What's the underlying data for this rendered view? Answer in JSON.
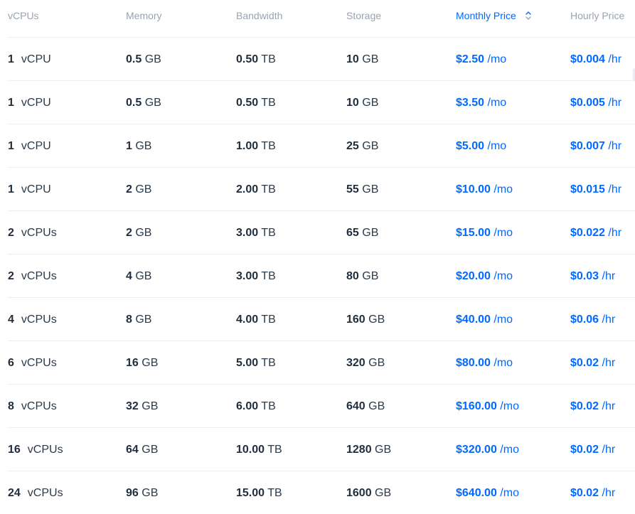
{
  "headers": {
    "vcpus": "vCPUs",
    "memory": "Memory",
    "bandwidth": "Bandwidth",
    "storage": "Storage",
    "monthly_price": "Monthly Price",
    "hourly_price": "Hourly Price"
  },
  "accent_color": "#0069ff",
  "sort_icon": "sort-up-down-icon",
  "rows": [
    {
      "vcpu": "1",
      "vcpu_unit": "vCPU",
      "memory": "0.5",
      "memory_unit": "GB",
      "bandwidth": "0.50",
      "bandwidth_unit": "TB",
      "storage": "10",
      "storage_unit": "GB",
      "monthly": "$2.50",
      "monthly_unit": "/mo",
      "hourly": "$0.004",
      "hourly_unit": "/hr"
    },
    {
      "vcpu": "1",
      "vcpu_unit": "vCPU",
      "memory": "0.5",
      "memory_unit": "GB",
      "bandwidth": "0.50",
      "bandwidth_unit": "TB",
      "storage": "10",
      "storage_unit": "GB",
      "monthly": "$3.50",
      "monthly_unit": "/mo",
      "hourly": "$0.005",
      "hourly_unit": "/hr"
    },
    {
      "vcpu": "1",
      "vcpu_unit": "vCPU",
      "memory": "1",
      "memory_unit": "GB",
      "bandwidth": "1.00",
      "bandwidth_unit": "TB",
      "storage": "25",
      "storage_unit": "GB",
      "monthly": "$5.00",
      "monthly_unit": "/mo",
      "hourly": "$0.007",
      "hourly_unit": "/hr"
    },
    {
      "vcpu": "1",
      "vcpu_unit": "vCPU",
      "memory": "2",
      "memory_unit": "GB",
      "bandwidth": "2.00",
      "bandwidth_unit": "TB",
      "storage": "55",
      "storage_unit": "GB",
      "monthly": "$10.00",
      "monthly_unit": "/mo",
      "hourly": "$0.015",
      "hourly_unit": "/hr"
    },
    {
      "vcpu": "2",
      "vcpu_unit": "vCPUs",
      "memory": "2",
      "memory_unit": "GB",
      "bandwidth": "3.00",
      "bandwidth_unit": "TB",
      "storage": "65",
      "storage_unit": "GB",
      "monthly": "$15.00",
      "monthly_unit": "/mo",
      "hourly": "$0.022",
      "hourly_unit": "/hr"
    },
    {
      "vcpu": "2",
      "vcpu_unit": "vCPUs",
      "memory": "4",
      "memory_unit": "GB",
      "bandwidth": "3.00",
      "bandwidth_unit": "TB",
      "storage": "80",
      "storage_unit": "GB",
      "monthly": "$20.00",
      "monthly_unit": "/mo",
      "hourly": "$0.03",
      "hourly_unit": "/hr"
    },
    {
      "vcpu": "4",
      "vcpu_unit": "vCPUs",
      "memory": "8",
      "memory_unit": "GB",
      "bandwidth": "4.00",
      "bandwidth_unit": "TB",
      "storage": "160",
      "storage_unit": "GB",
      "monthly": "$40.00",
      "monthly_unit": "/mo",
      "hourly": "$0.06",
      "hourly_unit": "/hr"
    },
    {
      "vcpu": "6",
      "vcpu_unit": "vCPUs",
      "memory": "16",
      "memory_unit": "GB",
      "bandwidth": "5.00",
      "bandwidth_unit": "TB",
      "storage": "320",
      "storage_unit": "GB",
      "monthly": "$80.00",
      "monthly_unit": "/mo",
      "hourly": "$0.02",
      "hourly_unit": "/hr"
    },
    {
      "vcpu": "8",
      "vcpu_unit": "vCPUs",
      "memory": "32",
      "memory_unit": "GB",
      "bandwidth": "6.00",
      "bandwidth_unit": "TB",
      "storage": "640",
      "storage_unit": "GB",
      "monthly": "$160.00",
      "monthly_unit": "/mo",
      "hourly": "$0.02",
      "hourly_unit": "/hr"
    },
    {
      "vcpu": "16",
      "vcpu_unit": "vCPUs",
      "memory": "64",
      "memory_unit": "GB",
      "bandwidth": "10.00",
      "bandwidth_unit": "TB",
      "storage": "1280",
      "storage_unit": "GB",
      "monthly": "$320.00",
      "monthly_unit": "/mo",
      "hourly": "$0.02",
      "hourly_unit": "/hr"
    },
    {
      "vcpu": "24",
      "vcpu_unit": "vCPUs",
      "memory": "96",
      "memory_unit": "GB",
      "bandwidth": "15.00",
      "bandwidth_unit": "TB",
      "storage": "1600",
      "storage_unit": "GB",
      "monthly": "$640.00",
      "monthly_unit": "/mo",
      "hourly": "$0.02",
      "hourly_unit": "/hr"
    }
  ]
}
